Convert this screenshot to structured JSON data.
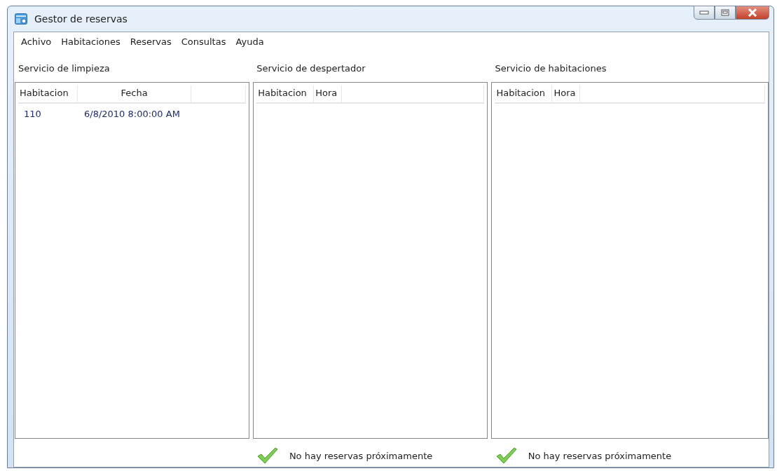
{
  "window": {
    "title": "Gestor de reservas"
  },
  "menu": [
    "Achivo",
    "Habitaciones",
    "Reservas",
    "Consultas",
    "Ayuda"
  ],
  "panels": [
    {
      "title": "Servicio de limpieza",
      "columns": [
        "Habitacion",
        "Fecha"
      ],
      "rows": [
        [
          "110",
          "6/8/2010 8:00:00 AM"
        ]
      ]
    },
    {
      "title": "Servicio de despertador",
      "columns": [
        "Habitacion",
        "Hora"
      ],
      "status": "No hay reservas próximamente"
    },
    {
      "title": "Servicio de habitaciones",
      "columns": [
        "Habitacion",
        "Hora"
      ],
      "status": "No hay reservas próximamente"
    }
  ]
}
